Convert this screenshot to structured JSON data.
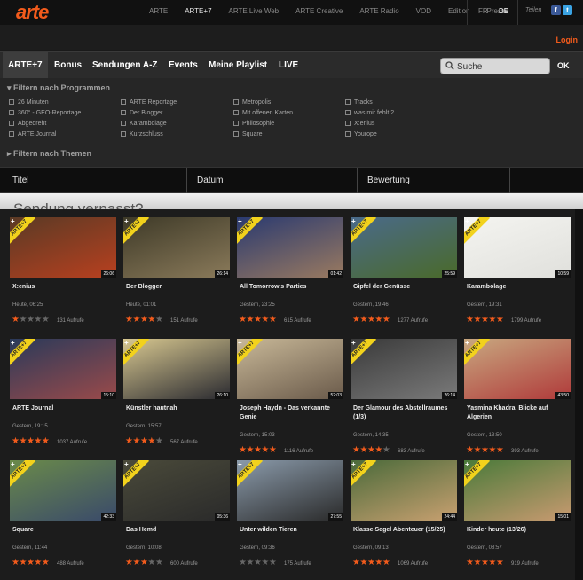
{
  "brand": {
    "logo": "arte",
    "accent": "#f25b1c"
  },
  "top_nav": [
    "ARTE",
    "ARTE+7",
    "ARTE Live Web",
    "ARTE Creative",
    "ARTE Radio",
    "VOD",
    "Edition",
    "Presse"
  ],
  "top_nav_active": "ARTE+7",
  "languages": [
    "FR",
    "DE"
  ],
  "language_active": "DE",
  "share_label": "Teilen",
  "login": "Login",
  "main_nav": [
    "ARTE+7",
    "Bonus",
    "Sendungen A-Z",
    "Events",
    "Meine Playlist",
    "LIVE"
  ],
  "search": {
    "value": "Suche",
    "button": "OK"
  },
  "filter": {
    "programs_heading": "Filtern nach Programmen",
    "themes_heading": "Filtern nach Themen",
    "columns": [
      [
        "26 Minuten",
        "360° - GEO-Reportage",
        "Abgedreht",
        "ARTE Journal"
      ],
      [
        "ARTE Reportage",
        "Der Blogger",
        "Karambolage",
        "Kurzschluss"
      ],
      [
        "Metropolis",
        "Mit offenen Karten",
        "Philosophie",
        "Square"
      ],
      [
        "Tracks",
        "was mir fehlt 2",
        "X:enius",
        "Yourope"
      ]
    ]
  },
  "table_headers": [
    "Titel",
    "Datum",
    "Bewertung"
  ],
  "banner_text": "Sendung verpasst?",
  "badge_text": "ARTE+7",
  "videos": [
    {
      "title": "X:enius",
      "date": "Heute, 06:25",
      "views": "131 Aufrufe",
      "stars": 1,
      "duration": "26:06",
      "thumb": [
        "#5a3a25",
        "#b8401f"
      ]
    },
    {
      "title": "Der Blogger",
      "date": "Heute, 01:01",
      "views": "151 Aufrufe",
      "stars": 4,
      "duration": "26:14",
      "thumb": [
        "#3e3a28",
        "#8a7a5a"
      ]
    },
    {
      "title": "All Tomorrow's Parties",
      "date": "Gestern, 23:25",
      "views": "615 Aufrufe",
      "stars": 5,
      "duration": "01:42",
      "thumb": [
        "#2a3a70",
        "#9a7a60"
      ]
    },
    {
      "title": "Gipfel der Genüsse",
      "date": "Gestern, 19:46",
      "views": "1277 Aufrufe",
      "stars": 5,
      "duration": "25:59",
      "thumb": [
        "#4a6a8a",
        "#4a6a2a"
      ]
    },
    {
      "title": "Karambolage",
      "date": "Gestern, 19:31",
      "views": "1799 Aufrufe",
      "stars": 5,
      "duration": "10:59",
      "thumb": [
        "#f4f4f0",
        "#e0e0dc"
      ]
    },
    {
      "title": "ARTE Journal",
      "date": "Gestern, 19:15",
      "views": "1037 Aufrufe",
      "stars": 5,
      "duration": "15:10",
      "thumb": [
        "#2a3a5a",
        "#9a4a4a"
      ]
    },
    {
      "title": "Künstler hautnah",
      "date": "Gestern, 15:57",
      "views": "567 Aufrufe",
      "stars": 4,
      "duration": "26:10",
      "thumb": [
        "#d8c890",
        "#2a2a30"
      ]
    },
    {
      "title": "Joseph Haydn - Das verkannte Genie",
      "date": "Gestern, 15:03",
      "views": "1116 Aufrufe",
      "stars": 5,
      "duration": "52:03",
      "thumb": [
        "#c8b898",
        "#6a5a4a"
      ]
    },
    {
      "title": "Der Glamour des Abstellraumes (1/3)",
      "date": "Gestern, 14:35",
      "views": "683 Aufrufe",
      "stars": 4,
      "duration": "26:14",
      "thumb": [
        "#3a3a3a",
        "#7a7a7a"
      ]
    },
    {
      "title": "Yasmina Khadra, Blicke auf Algerien",
      "date": "Gestern, 13:50",
      "views": "393 Aufrufe",
      "stars": 5,
      "duration": "43:50",
      "thumb": [
        "#c8a880",
        "#b03a3a"
      ]
    },
    {
      "title": "Square",
      "date": "Gestern, 11:44",
      "views": "488 Aufrufe",
      "stars": 5,
      "duration": "42:33",
      "thumb": [
        "#6a8a4a",
        "#3a4a6a"
      ]
    },
    {
      "title": "Das Hemd",
      "date": "Gestern, 10:08",
      "views": "600 Aufrufe",
      "stars": 3,
      "duration": "05:36",
      "thumb": [
        "#4a4a3a",
        "#2a2a2a"
      ]
    },
    {
      "title": "Unter wilden Tieren",
      "date": "Gestern, 09:36",
      "views": "175 Aufrufe",
      "stars": 0,
      "duration": "27:55",
      "thumb": [
        "#8a9aaa",
        "#2a2a2a"
      ]
    },
    {
      "title": "Klasse Segel Abenteuer (15/25)",
      "date": "Gestern, 09:13",
      "views": "1069 Aufrufe",
      "stars": 5,
      "duration": "24:44",
      "thumb": [
        "#4a6a3a",
        "#c8a070"
      ]
    },
    {
      "title": "Kinder heute (13/26)",
      "date": "Gestern, 08:57",
      "views": "919 Aufrufe",
      "stars": 5,
      "duration": "15:01",
      "thumb": [
        "#4a7a3a",
        "#c89a70"
      ]
    }
  ]
}
